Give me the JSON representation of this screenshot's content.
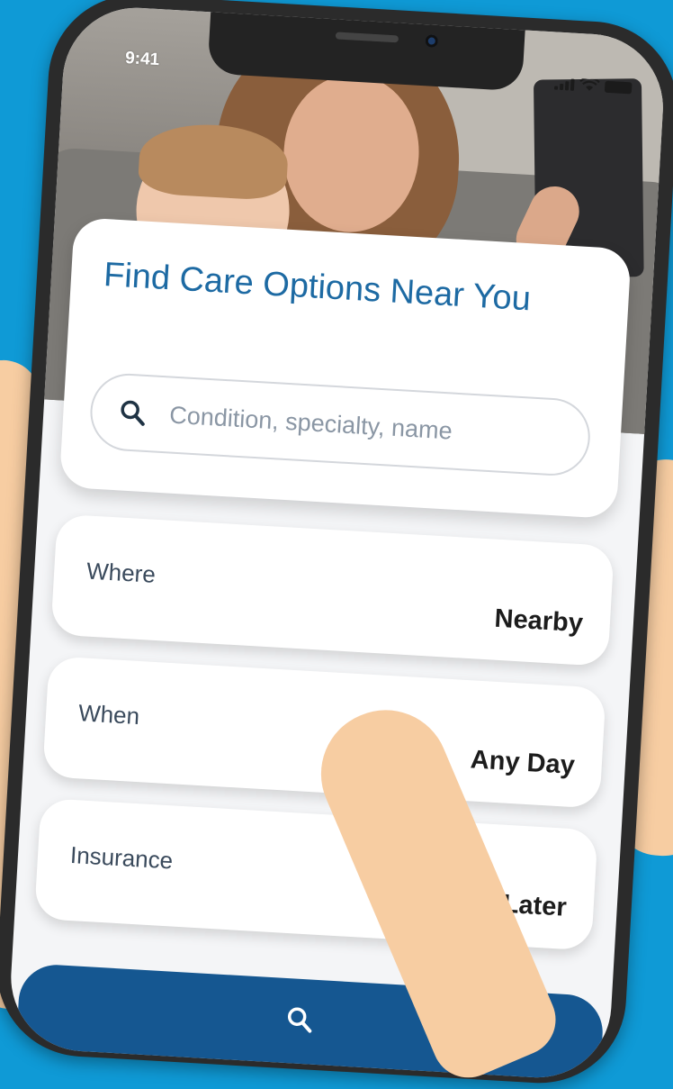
{
  "status_bar": {
    "time": "9:41"
  },
  "search_card": {
    "title": "Find Care Options Near You",
    "search": {
      "placeholder": "Condition, specialty, name",
      "icon": "search-icon"
    }
  },
  "filters": [
    {
      "label": "Where",
      "value": "Nearby"
    },
    {
      "label": "When",
      "value": "Any Day"
    },
    {
      "label": "Insurance",
      "value": "I Later"
    }
  ],
  "colors": {
    "background": "#0f9ad6",
    "title": "#1d6aa3",
    "primary_button": "#155791",
    "skin": "#f7cda2"
  }
}
